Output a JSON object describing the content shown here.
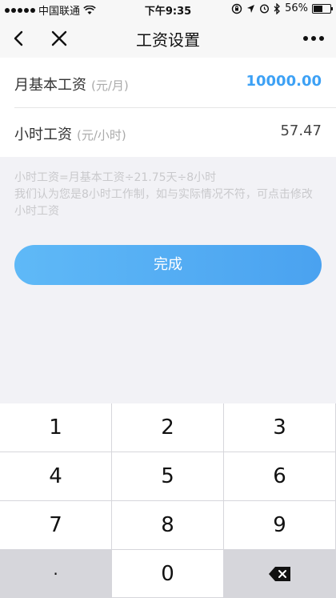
{
  "status_bar": {
    "carrier": "中国联通",
    "time": "下午9:35",
    "battery_percent": "56%",
    "battery_level": 0.56
  },
  "nav": {
    "title": "工资设置"
  },
  "rows": [
    {
      "label": "月基本工资",
      "unit": "(元/月)",
      "value": "10000.00"
    },
    {
      "label": "小时工资",
      "unit": "(元/小时)",
      "value": "57.47"
    }
  ],
  "hint": {
    "line1": "小时工资=月基本工资÷21.75天÷8小时",
    "line2": "我们认为您是8小时工作制，如与实际情况不符，可点击修改小时工资"
  },
  "done_button": {
    "label": "完成"
  },
  "keypad": {
    "keys": [
      "1",
      "2",
      "3",
      "4",
      "5",
      "6",
      "7",
      "8",
      "9",
      "·",
      "0"
    ]
  },
  "colors": {
    "accent": "#3da1f5",
    "button_gradient_start": "#5fb9f7",
    "button_gradient_end": "#4aa2f0"
  }
}
